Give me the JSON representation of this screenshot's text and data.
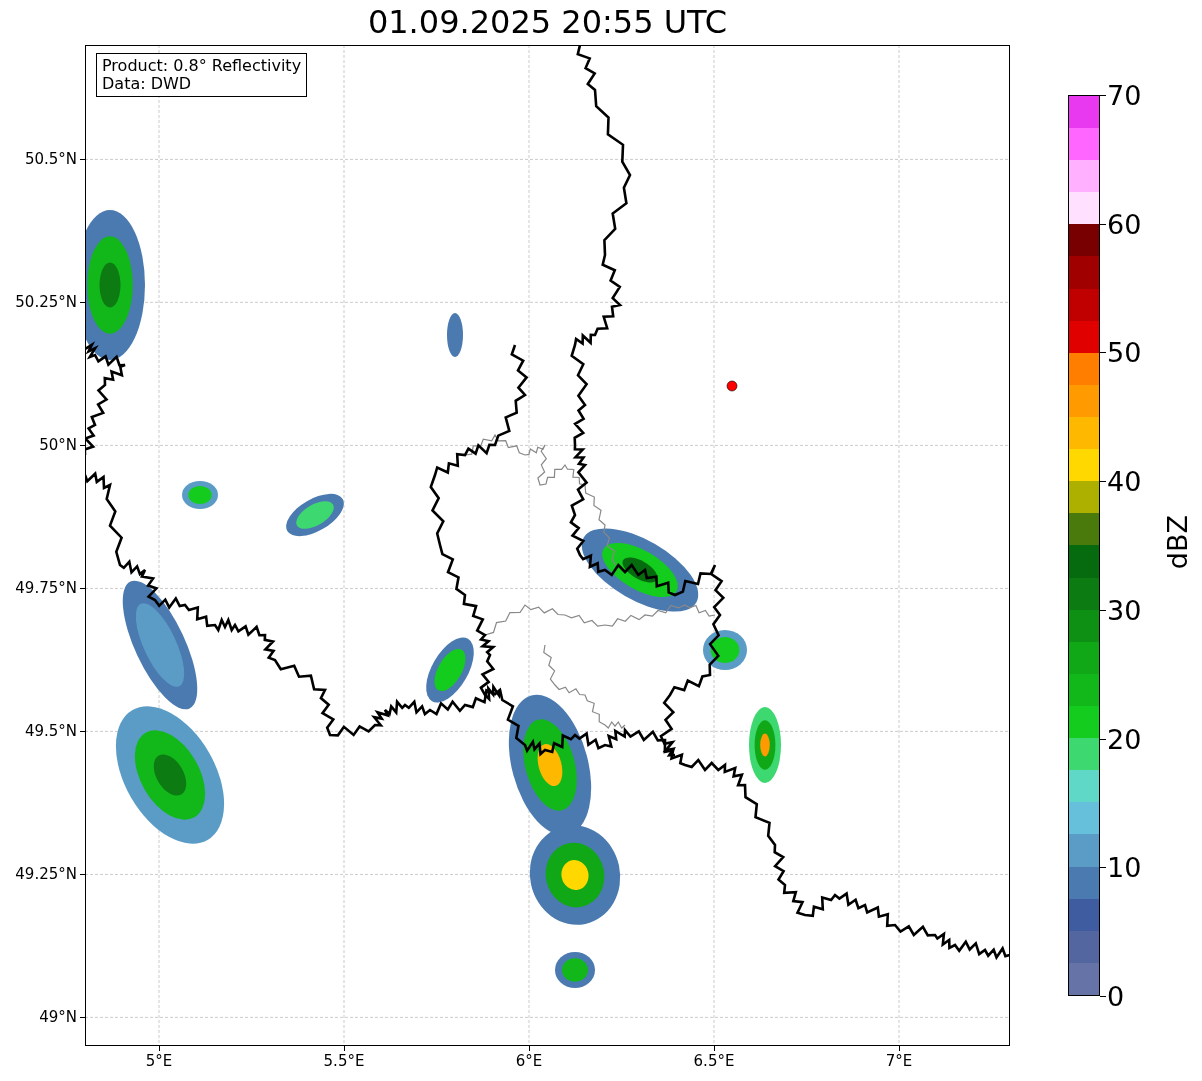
{
  "title": "01.09.2025 20:55 UTC",
  "legend": [
    "Product: 0.8° Reflectivity",
    "Data: DWD"
  ],
  "x_ticks": [
    "5°E",
    "5.5°E",
    "6°E",
    "6.5°E",
    "7°E"
  ],
  "y_ticks": [
    "50.5°N",
    "50.25°N",
    "50°N",
    "49.75°N",
    "49.5°N",
    "49.25°N",
    "49°N"
  ],
  "colorbar": {
    "label": "dBZ",
    "ticks": [
      "70",
      "60",
      "50",
      "40",
      "30",
      "20",
      "10",
      "0"
    ],
    "bands": [
      {
        "color": "#6673a6"
      },
      {
        "color": "#5366a0"
      },
      {
        "color": "#405ca0"
      },
      {
        "color": "#4a7ab0"
      },
      {
        "color": "#5a9cc6"
      },
      {
        "color": "#66c0dc"
      },
      {
        "color": "#60d8c8"
      },
      {
        "color": "#3ed870"
      },
      {
        "color": "#14cc1e"
      },
      {
        "color": "#12b81a"
      },
      {
        "color": "#10a816"
      },
      {
        "color": "#0e9014"
      },
      {
        "color": "#0c7c12"
      },
      {
        "color": "#066a0e"
      },
      {
        "color": "#4a7a0c"
      },
      {
        "color": "#aeb000"
      },
      {
        "color": "#ffd800"
      },
      {
        "color": "#ffb800"
      },
      {
        "color": "#ff9a00"
      },
      {
        "color": "#ff7e00"
      },
      {
        "color": "#e00000"
      },
      {
        "color": "#c00000"
      },
      {
        "color": "#a00000"
      },
      {
        "color": "#780000"
      },
      {
        "color": "#ffe0ff"
      },
      {
        "color": "#ffb0ff"
      },
      {
        "color": "#ff66ff"
      },
      {
        "color": "#e838f0"
      }
    ]
  }
}
